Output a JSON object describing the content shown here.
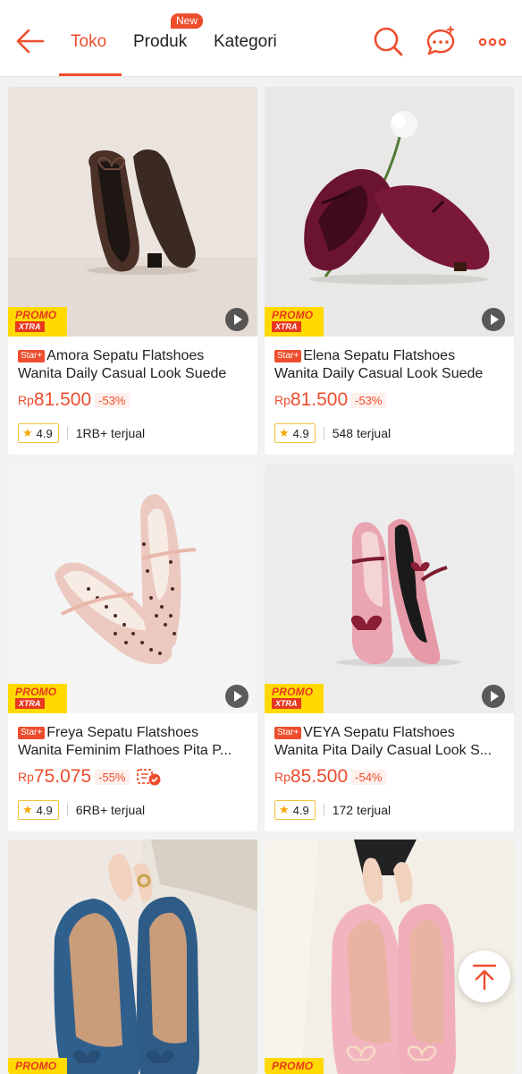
{
  "header": {
    "tabs": [
      {
        "label": "Toko"
      },
      {
        "label": "Produk"
      },
      {
        "label": "Kategori"
      }
    ],
    "new_badge": "New"
  },
  "products": [
    {
      "badge": "Star+",
      "title_line1": "Amora Sepatu Flatshoes",
      "title_line2": "Wanita Daily Casual Look Suede",
      "currency": "Rp",
      "price": "81.500",
      "discount": "-53%",
      "rating": "4.9",
      "sold": "1RB+ terjual",
      "promo": "PROMO",
      "promo_sub": "XTRA"
    },
    {
      "badge": "Star+",
      "title_line1": "Elena Sepatu Flatshoes",
      "title_line2": "Wanita Daily Casual Look Suede",
      "currency": "Rp",
      "price": "81.500",
      "discount": "-53%",
      "rating": "4.9",
      "sold": "548 terjual",
      "promo": "PROMO",
      "promo_sub": "XTRA"
    },
    {
      "badge": "Star+",
      "title_line1": "Freya Sepatu Flatshoes",
      "title_line2": "Wanita Feminim Flathoes Pita P...",
      "currency": "Rp",
      "price": "75.075",
      "discount": "-55%",
      "rating": "4.9",
      "sold": "6RB+ terjual",
      "promo": "PROMO",
      "promo_sub": "XTRA"
    },
    {
      "badge": "Star+",
      "title_line1": "VEYA Sepatu Flatshoes",
      "title_line2": "Wanita Pita Daily Casual Look S...",
      "currency": "Rp",
      "price": "85.500",
      "discount": "-54%",
      "rating": "4.9",
      "sold": "172 terjual",
      "promo": "PROMO",
      "promo_sub": "XTRA"
    },
    {
      "promo": "PROMO"
    },
    {
      "promo": "PROMO"
    }
  ],
  "colors": {
    "accent": "#ee4d2d",
    "promo_bg": "#ffd900",
    "star": "#f6a700"
  },
  "icons": [
    "back-arrow-icon",
    "search-icon",
    "chat-icon",
    "more-icon",
    "play-icon",
    "free-shipping-icon",
    "star-icon",
    "scroll-top-icon"
  ]
}
